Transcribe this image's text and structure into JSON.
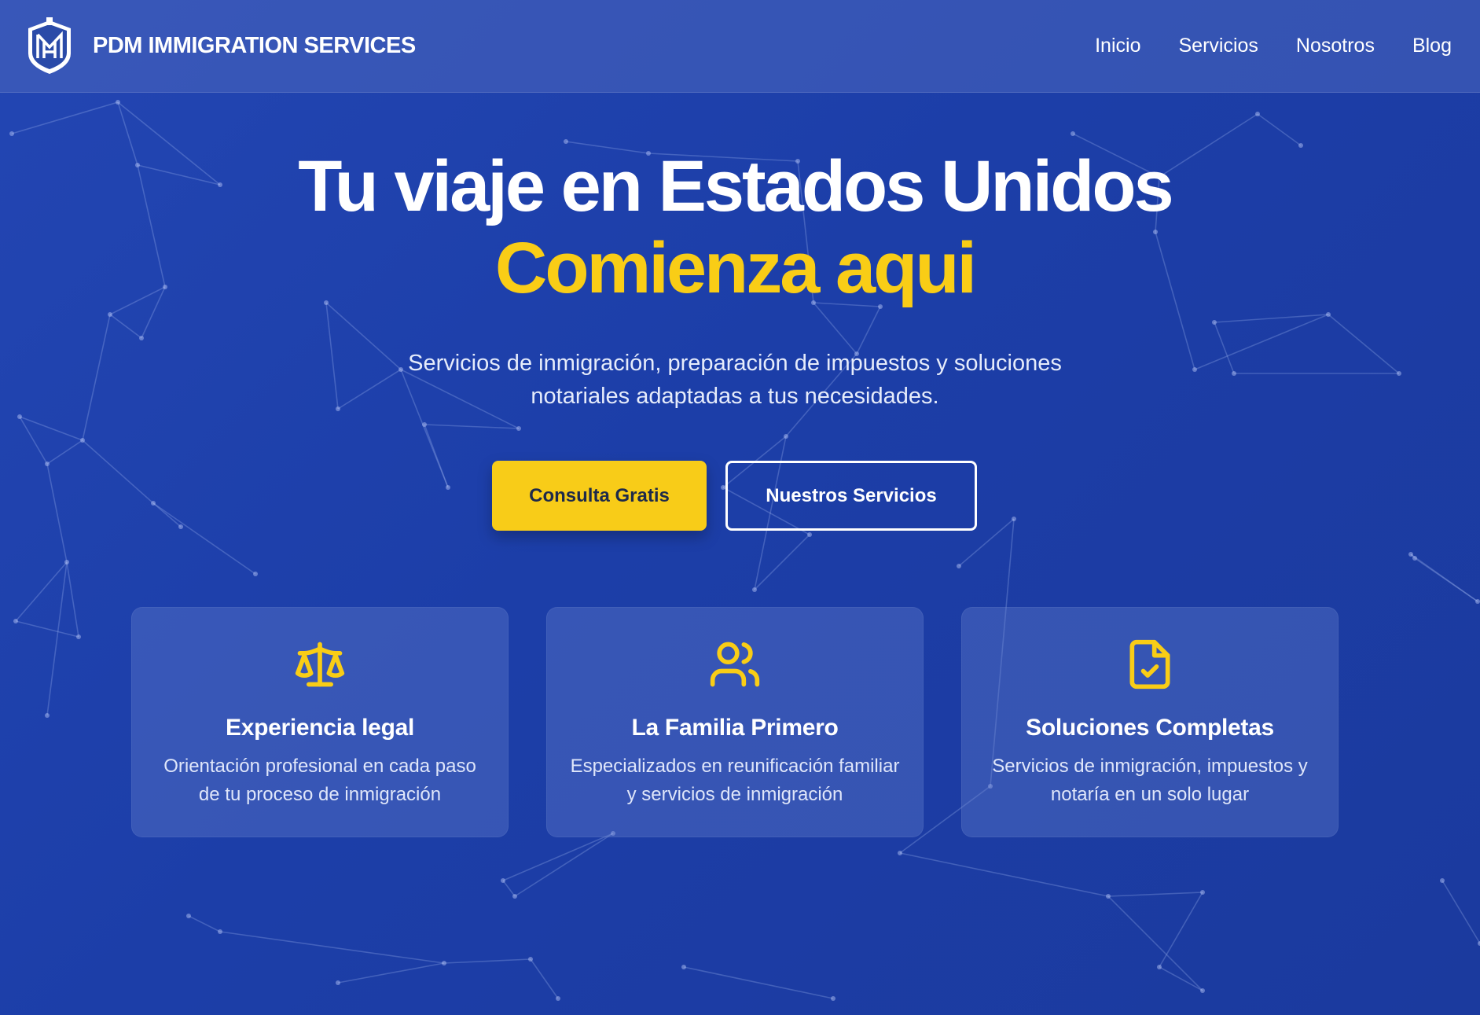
{
  "header": {
    "brand_name": "PDM IMMIGRATION SERVICES",
    "logo_icon": "shield-monogram-logo",
    "nav": [
      {
        "label": "Inicio"
      },
      {
        "label": "Servicios"
      },
      {
        "label": "Nosotros"
      },
      {
        "label": "Blog"
      }
    ]
  },
  "hero": {
    "title_line1": "Tu viaje en Estados Unidos",
    "title_line2": "Comienza aqui",
    "subtitle": "Servicios de inmigración, preparación de impuestos y soluciones notariales adaptadas a tus necesidades.",
    "primary_button": "Consulta Gratis",
    "secondary_button": "Nuestros Servicios"
  },
  "features": [
    {
      "icon": "scale-icon",
      "title": "Experiencia legal",
      "text": "Orientación profesional en cada paso de tu proceso de inmigración"
    },
    {
      "icon": "users-icon",
      "title": "La Familia Primero",
      "text": "Especializados en reunificación familiar y servicios de inmigración"
    },
    {
      "icon": "file-check-icon",
      "title": "Soluciones Completas",
      "text": "Servicios de inmigración, impuestos y notaría en un solo lugar"
    }
  ],
  "colors": {
    "background": "#1f40aa",
    "accent": "#f9cd16",
    "text": "#ffffff"
  }
}
